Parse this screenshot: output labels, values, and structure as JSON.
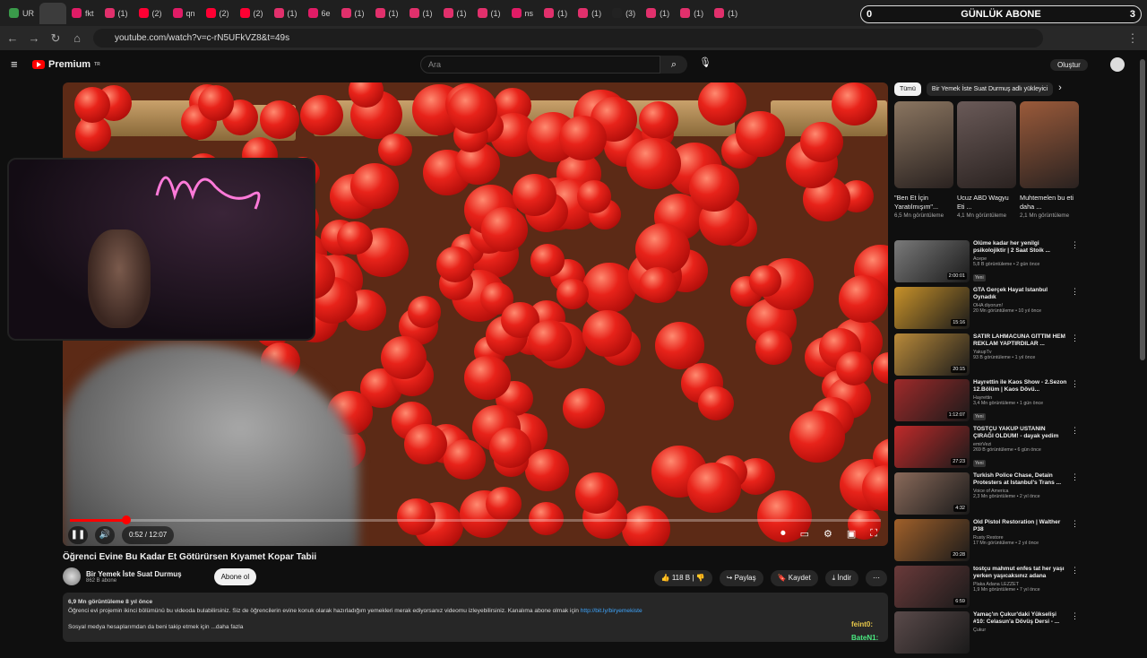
{
  "tabs": [
    {
      "label": "UR",
      "color": "#3a9a4a",
      "active": false
    },
    {
      "label": "",
      "color": "#3c3c3c",
      "active": true
    },
    {
      "label": "fkt",
      "color": "#e01c66"
    },
    {
      "label": "(1)",
      "color": "#e1306c"
    },
    {
      "label": "(2)",
      "color": "#ff0033"
    },
    {
      "label": "qn",
      "color": "#e01c66"
    },
    {
      "label": "(2)",
      "color": "#ff0033"
    },
    {
      "label": "(2)",
      "color": "#ff0033"
    },
    {
      "label": "(1)",
      "color": "#e1306c"
    },
    {
      "label": "6e",
      "color": "#e01c66"
    },
    {
      "label": "(1)",
      "color": "#e1306c"
    },
    {
      "label": "(1)",
      "color": "#e1306c"
    },
    {
      "label": "(1)",
      "color": "#e1306c"
    },
    {
      "label": "(1)",
      "color": "#e1306c"
    },
    {
      "label": "(1)",
      "color": "#e1306c"
    },
    {
      "label": "ns",
      "color": "#e01c66"
    },
    {
      "label": "(1)",
      "color": "#e1306c"
    },
    {
      "label": "(1)",
      "color": "#e1306c"
    },
    {
      "label": "(3)",
      "color": "#222222"
    },
    {
      "label": "(1)",
      "color": "#e1306c"
    },
    {
      "label": "(1)",
      "color": "#e1306c"
    },
    {
      "label": "(1)",
      "color": "#e1306c"
    }
  ],
  "overlay": {
    "left_count": "0",
    "label": "GÜNLÜK ABONE",
    "right_count": "3"
  },
  "url": "youtube.com/watch?v=c-rN5UFkVZ8&t=49s",
  "yt": {
    "brand": "Premium",
    "country": "TR",
    "search_placeholder": "Ara",
    "create": "Oluştur"
  },
  "player": {
    "time": "0:52 / 12:07",
    "progress": 0.07
  },
  "video": {
    "title": "Öğrenci Evine Bu Kadar Et Götürürsen Kıyamet Kopar Tabii",
    "channel": "Bir Yemek İste Suat Durmuş",
    "subs": "862 B abone",
    "subscribe": "Abone ol",
    "likes": "118 B",
    "share": "Paylaş",
    "save": "Kaydet",
    "download": "İndir",
    "views_line": "6,9 Mn görüntüleme  8 yıl önce",
    "desc1": "Öğrenci evi projemin ikinci bölümünü bu videoda bulabilirsiniz. Siz de öğrencilerin evine konuk olarak hazırladığım yemekleri merak ediyorsanız videomu izleyebilirsiniz. Kanalıma abone olmak için ",
    "link": "http://bit.ly/biryemekiste",
    "desc2": "Sosyal medya hesaplarımdan da beni takip etmek için  ...daha fazla"
  },
  "chips": [
    "Tümü",
    "Bir Yemek İste Suat Durmuş adlı yükleyici"
  ],
  "shorts": [
    {
      "title": "\"Ben Et İçin Yaratılmışım\"...",
      "views": "6,5 Mn görüntüleme",
      "color": "#8a7560"
    },
    {
      "title": "Ucuz ABD Wagyu Eti ...",
      "views": "4,1 Mn görüntüleme",
      "color": "#6a5a58"
    },
    {
      "title": "Muhtemelen bu eti daha ...",
      "views": "2,1 Mn görüntüleme",
      "color": "#9a5a3a"
    }
  ],
  "videos": [
    {
      "title": "Ölüme kadar her yenilgi psikolojiktir | 2 Saat Stoik ...",
      "channel": "Acepe",
      "meta": "5,8 B görüntüleme • 2 gün önce",
      "badge": "Yeni",
      "dur": "2:00:01",
      "color": "#7a7a7a"
    },
    {
      "title": "GTA Gerçek Hayat İstanbul Oynadık",
      "channel": "OHA diyorum!",
      "meta": "20 Mn görüntüleme • 10 yıl önce",
      "badge": "",
      "dur": "15:16",
      "color": "#c8922a"
    },
    {
      "title": "SATIR LAHMACUNA GİTTİM HEM REKLAM YAPTIRDILAR ...",
      "channel": "YakupTv",
      "meta": "93 B görüntüleme • 1 yıl önce",
      "badge": "",
      "dur": "20:15",
      "color": "#b98a3a"
    },
    {
      "title": "Hayrettin ile Kaos Show - 2.Sezon 12.Bölüm | Kaos Dövü...",
      "channel": "Hayrettin",
      "meta": "3,4 Mn görüntüleme • 1 gün önce",
      "badge": "Yeni",
      "dur": "1:12:07",
      "color": "#a02a2a"
    },
    {
      "title": "TOSTÇU YAKUP USTANIN ÇIRAĞI OLDUM! - dayak yedim",
      "channel": "emirVezi",
      "meta": "269 B görüntüleme • 6 gün önce",
      "badge": "Yeni",
      "dur": "27:23",
      "color": "#c02a2a"
    },
    {
      "title": "Turkish Police Chase, Detain Protesters at Istanbul's Trans ...",
      "channel": "Voice of America",
      "meta": "2,3 Mn görüntüleme • 2 yıl önce",
      "badge": "",
      "dur": "4:32",
      "color": "#8a6a5a"
    },
    {
      "title": "Old Pistol Restoration | Walther P38",
      "channel": "Rusty Restore",
      "meta": "17 Mn görüntüleme • 2 yıl önce",
      "badge": "",
      "dur": "20:28",
      "color": "#a0602a"
    },
    {
      "title": "tostçu mahmut enfes tat her yaşı yerken yaşıcaksınız adana",
      "channel": "Plaka Adana LEZZET",
      "meta": "1,9 Mn görüntüleme • 7 yıl önce",
      "badge": "",
      "dur": "6:59",
      "color": "#6a3a3a"
    },
    {
      "title": "Yamaç'ın Çukur'daki Yükselişi #10: Celasun'a Dövüş Dersi - ...",
      "channel": "Çukur",
      "meta": "",
      "badge": "",
      "dur": "",
      "color": "#5a4a4a"
    }
  ],
  "chat": [
    {
      "user": "feint0:",
      "color": "#e8c84a"
    },
    {
      "user": "BateN1:",
      "color": "#4ae880"
    }
  ]
}
